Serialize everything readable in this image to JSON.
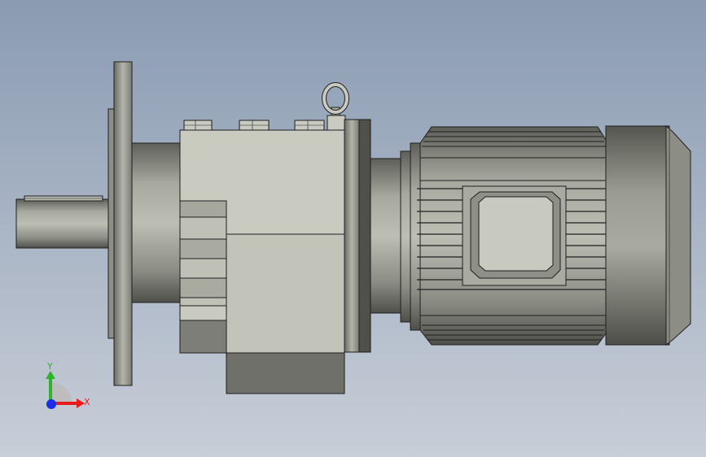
{
  "viewport": {
    "background_top": "#8c9db3",
    "background_bottom": "#c7cdd7",
    "model_name": "gear-motor-assembly",
    "view": "front"
  },
  "triad": {
    "y_label": "Y",
    "x_label": "X",
    "x_color": "#e81a1a",
    "y_color": "#2ab52a",
    "z_color": "#1a2ee8"
  },
  "colors": {
    "body_light": "#c8c9bf",
    "body_mid": "#a9aaa0",
    "body_dark": "#6f706a",
    "edge": "#1f1f1f"
  }
}
